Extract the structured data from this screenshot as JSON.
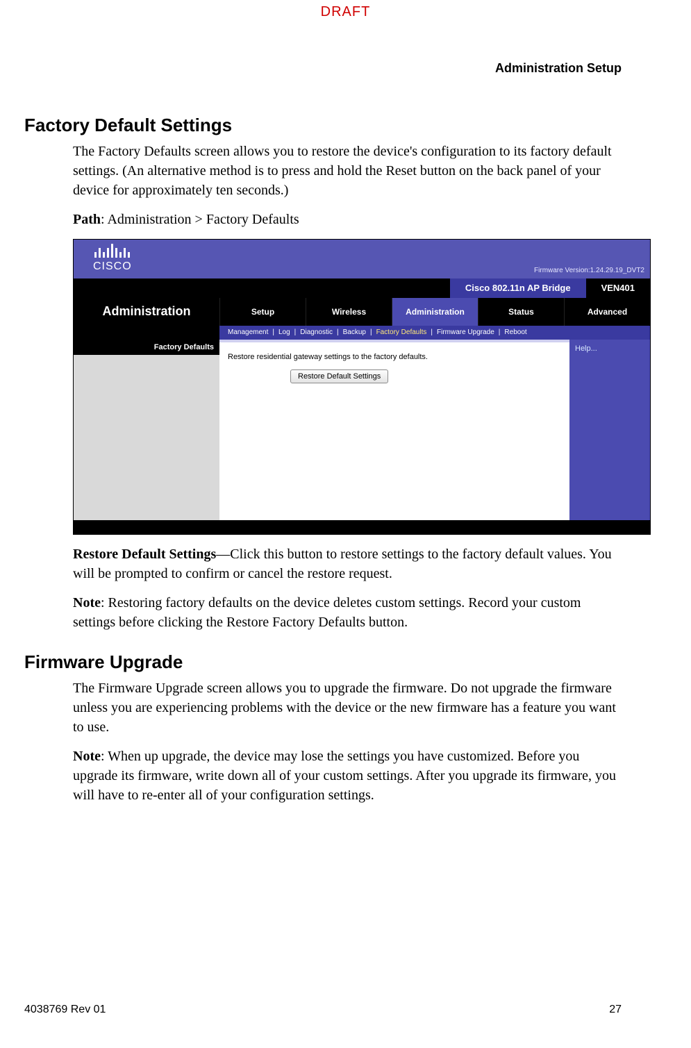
{
  "draft_label": "DRAFT",
  "header_right": "Administration Setup",
  "section1": {
    "title": "Factory Default Settings",
    "p1": "The Factory Defaults screen allows you to restore the device's configuration to its factory default settings. (An alternative method is to press and hold the Reset button on the back panel of your device for approximately ten seconds.)",
    "path_label": "Path",
    "path_value": ": Administration > Factory Defaults",
    "restore_label": "Restore Default Settings",
    "restore_text": "—Click this button to restore settings to the factory default values. You will be prompted to confirm or cancel the restore request.",
    "note_label": "Note",
    "note_text": ": Restoring factory defaults on the device deletes custom settings. Record your custom settings before clicking the Restore Factory Defaults button."
  },
  "section2": {
    "title": "Firmware Upgrade",
    "p1": "The Firmware Upgrade screen allows you to upgrade the firmware. Do not upgrade the firmware unless you are experiencing problems with the device or the new firmware has a feature you want to use.",
    "note_label": "Note",
    "note_text": ": When up upgrade, the device may lose the settings you have customized. Before you upgrade its firmware, write down all of your custom settings. After you upgrade its firmware, you will have to re-enter all of your configuration settings."
  },
  "shot": {
    "brand": "CISCO",
    "firmware": "Firmware Version:1.24.29.19_DVT2",
    "model": "Cisco 802.11n AP Bridge",
    "sku": "VEN401",
    "nav_title": "Administration",
    "tabs": [
      "Setup",
      "Wireless",
      "Administration",
      "Status",
      "Advanced"
    ],
    "active_tab_index": 2,
    "subtabs": [
      "Management",
      "Log",
      "Diagnostic",
      "Backup",
      "Factory Defaults",
      "Firmware Upgrade",
      "Reboot"
    ],
    "active_subtab_index": 4,
    "side_label": "Factory Defaults",
    "center_text": "Restore residential gateway settings to the factory defaults.",
    "button": "Restore Default Settings",
    "help": "Help..."
  },
  "footer": {
    "left": "4038769 Rev 01",
    "right": "27"
  }
}
